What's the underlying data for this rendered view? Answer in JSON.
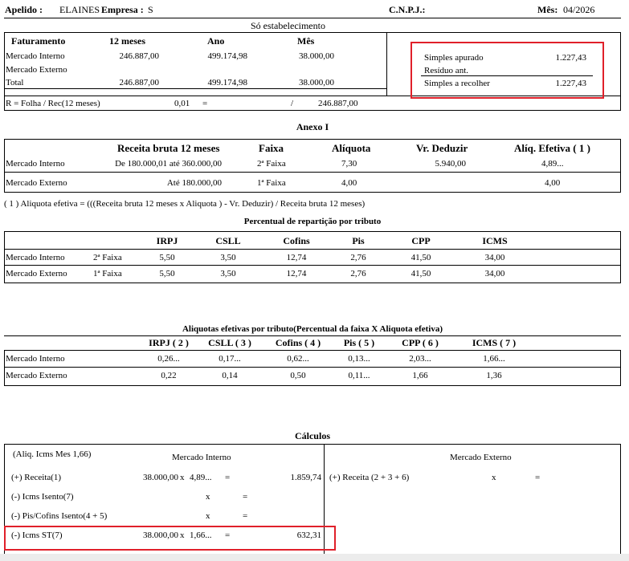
{
  "header": {
    "apelido_label": "Apelido :",
    "apelido_value": "ELAINES",
    "empresa_label": "Empresa :",
    "empresa_value": "S",
    "cnpj_label": "C.N.P.J.:",
    "mes_label": "Mês:",
    "mes_value": "04/2026",
    "subtitle": "Só estabelecimento"
  },
  "faturamento": {
    "headers": [
      "Faturamento",
      "12  meses",
      "Ano",
      "Mês"
    ],
    "rows": [
      {
        "label": "Mercado Interno",
        "m12": "246.887,00",
        "ano": "499.174,98",
        "mes": "38.000,00"
      },
      {
        "label": "Mercado Externo",
        "m12": "",
        "ano": "",
        "mes": ""
      },
      {
        "label": "Total",
        "m12": "246.887,00",
        "ano": "499.174,98",
        "mes": "38.000,00"
      }
    ],
    "simples": [
      {
        "label": "Simples apurado",
        "value": "1.227,43"
      },
      {
        "label": "Resíduo ant.",
        "value": ""
      },
      {
        "label": "Simples a recolher",
        "value": "1.227,43"
      }
    ],
    "r_label": "R = Folha / Rec(12 meses)",
    "r_value": "0,01",
    "r_eq": "=",
    "r_slash": "/",
    "r_den": "246.887,00"
  },
  "anexo": {
    "title": "Anexo I",
    "headers": [
      "Receita bruta 12 meses",
      "Faixa",
      "Alíquota",
      "Vr. Deduzir",
      "Alíq. Efetiva ( 1 )"
    ],
    "rows": [
      {
        "label": "Mercado  Interno",
        "receita": "De  180.000,01  até  360.000,00",
        "faixa": "2ª Faixa",
        "aliquota": "7,30",
        "deduzir": "5.940,00",
        "efetiva": "4,89..."
      },
      {
        "label": "Mercado  Externo",
        "receita": "Até  180.000,00",
        "faixa": "1ª Faixa",
        "aliquota": "4,00",
        "deduzir": "",
        "efetiva": "4,00"
      }
    ],
    "note": "( 1 ) Aliquota efetiva = (((Receita bruta 12 meses x Aliquota ) -  Vr. Deduzir) / Receita bruta 12 meses)"
  },
  "reparticao": {
    "title": "Percentual  de  repartição  por  tributo",
    "headers": [
      "IRPJ",
      "CSLL",
      "Cofins",
      "Pis",
      "CPP",
      "ICMS"
    ],
    "rows": [
      {
        "label": "Mercado  Interno",
        "faixa": "2ª  Faixa",
        "vals": [
          "5,50",
          "3,50",
          "12,74",
          "2,76",
          "41,50",
          "34,00"
        ]
      },
      {
        "label": "Mercado  Externo",
        "faixa": "1ª  Faixa",
        "vals": [
          "5,50",
          "3,50",
          "12,74",
          "2,76",
          "41,50",
          "34,00"
        ]
      }
    ]
  },
  "efetivas": {
    "title": "Aliquotas  efetivas  por  tributo(Percentual  da  faixa  X  Aliquota  efetiva)",
    "headers": [
      "IRPJ ( 2 )",
      "CSLL ( 3 )",
      "Cofins ( 4 )",
      "Pis ( 5 )",
      "CPP ( 6 )",
      "ICMS ( 7 )"
    ],
    "rows": [
      {
        "label": "Mercado  Interno",
        "vals": [
          "0,26...",
          "0,17...",
          "0,62...",
          "0,13...",
          "2,03...",
          "1,66..."
        ]
      },
      {
        "label": "Mercado  Externo",
        "vals": [
          "0,22",
          "0,14",
          "0,50",
          "0,11...",
          "1,66",
          "1,36"
        ]
      }
    ]
  },
  "calculos": {
    "title": "Cálculos",
    "aliq_icms": "(Aliq. Icms Mes 1,66)",
    "mi_header": "Mercado  Interno",
    "me_header": "Mercado  Externo",
    "rows": [
      {
        "label": "(+)  Receita(1)",
        "a": "38.000,00",
        "x": "x",
        "b": "4,89...",
        "eq": "=",
        "res": "1.859,74"
      },
      {
        "label": "(-)  Icms Isento(7)",
        "a": "",
        "x": "x",
        "b": "",
        "eq": "=",
        "res": ""
      },
      {
        "label": "(-)  Pis/Cofins Isento(4 + 5)",
        "a": "",
        "x": "x",
        "b": "",
        "eq": "=",
        "res": ""
      },
      {
        "label": "(-)  Icms ST(7)",
        "a": "38.000,00",
        "x": "x",
        "b": "1,66...",
        "eq": "=",
        "res": "632,31"
      }
    ],
    "me_row": {
      "label": "(+) Receita (2 + 3 + 6)",
      "x": "x",
      "eq": "="
    }
  },
  "colors": {
    "highlight": "#e0202a"
  }
}
